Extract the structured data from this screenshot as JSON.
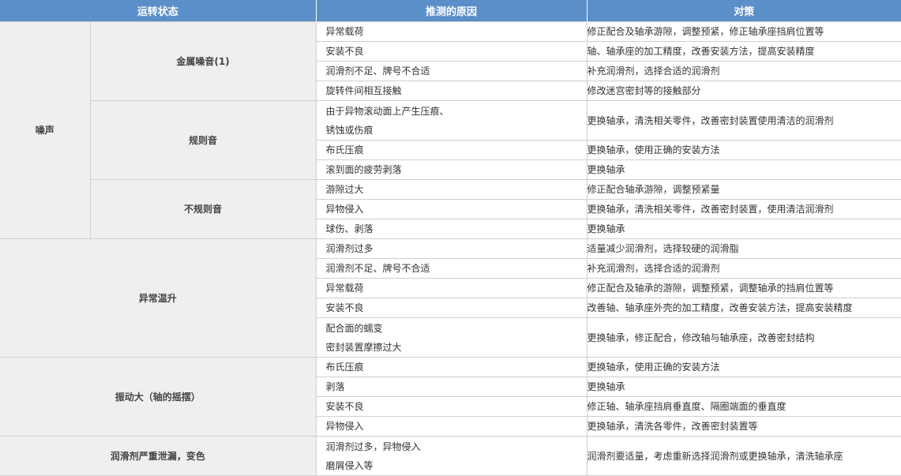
{
  "headers": [
    "运转状态",
    "推测的原因",
    "对策"
  ],
  "groups": {
    "noise": "噪声",
    "metal_noise": "金属噪音(1)",
    "regular_noise": "规则音",
    "irregular_noise": "不规则音",
    "abnormal_temp": "异常温升",
    "vibration": "振动大（轴的摇摆）",
    "lube_leak": "润滑剂严重泄漏，变色"
  },
  "rows": [
    {
      "cause": [
        "异常载荷"
      ],
      "remedy": "修正配合及轴承游隙，调整预紧，修正轴承座挡肩位置等"
    },
    {
      "cause": [
        "安装不良"
      ],
      "remedy": "轴、轴承座的加工精度，改善安装方法，提高安装精度"
    },
    {
      "cause": [
        "润滑剂不足、牌号不合适"
      ],
      "remedy": "补充润滑剂，选择合适的润滑剂"
    },
    {
      "cause": [
        "旋转件间相互接触"
      ],
      "remedy": "修改迷宫密封等的接触部分"
    },
    {
      "cause": [
        "由于异物滚动面上产生压痕、",
        "锈蚀或伤痕"
      ],
      "remedy": "更换轴承，清洗相关零件，改善密封装置使用清洁的润滑剂"
    },
    {
      "cause": [
        "布氏压痕"
      ],
      "remedy": "更换轴承，使用正确的安装方法"
    },
    {
      "cause": [
        "滚到面的疲劳剥落"
      ],
      "remedy": "更换轴承"
    },
    {
      "cause": [
        "游隙过大"
      ],
      "remedy": "修正配合轴承游隙，调整预紧量"
    },
    {
      "cause": [
        "异物侵入"
      ],
      "remedy": "更换轴承，清洗相关零件，改善密封装置，使用清洁润滑剂"
    },
    {
      "cause": [
        "球伤、剥落"
      ],
      "remedy": "更换轴承"
    },
    {
      "cause": [
        "润滑剂过多"
      ],
      "remedy": "适量减少润滑剂，选择较硬的润滑脂"
    },
    {
      "cause": [
        "润滑剂不足、牌号不合适"
      ],
      "remedy": "补充润滑剂，选择合适的润滑剂"
    },
    {
      "cause": [
        "异常载荷"
      ],
      "remedy": "修正配合及轴承的游隙，调整预紧，调整轴承的挡肩位置等"
    },
    {
      "cause": [
        "安装不良"
      ],
      "remedy": "改善轴、轴承座外壳的加工精度，改善安装方法，提高安装精度"
    },
    {
      "cause": [
        "配合面的蠕变",
        "密封装置摩擦过大"
      ],
      "remedy": "更换轴承，修正配合，修改轴与轴承座，改善密封结构"
    },
    {
      "cause": [
        "布氏压痕"
      ],
      "remedy": "更换轴承，使用正确的安装方法"
    },
    {
      "cause": [
        "剥落"
      ],
      "remedy": "更换轴承"
    },
    {
      "cause": [
        "安装不良"
      ],
      "remedy": "修正轴、轴承座挡肩垂直度、隔圈端面的垂直度"
    },
    {
      "cause": [
        "异物侵入"
      ],
      "remedy": "更换轴承，清洗各零件，改善密封装置等"
    },
    {
      "cause": [
        "润滑剂过多，异物侵入",
        "磨屑侵入等"
      ],
      "remedy": "润滑剂要适量，考虑重新选择润滑剂或更换轴承，清洗轴承座"
    }
  ]
}
